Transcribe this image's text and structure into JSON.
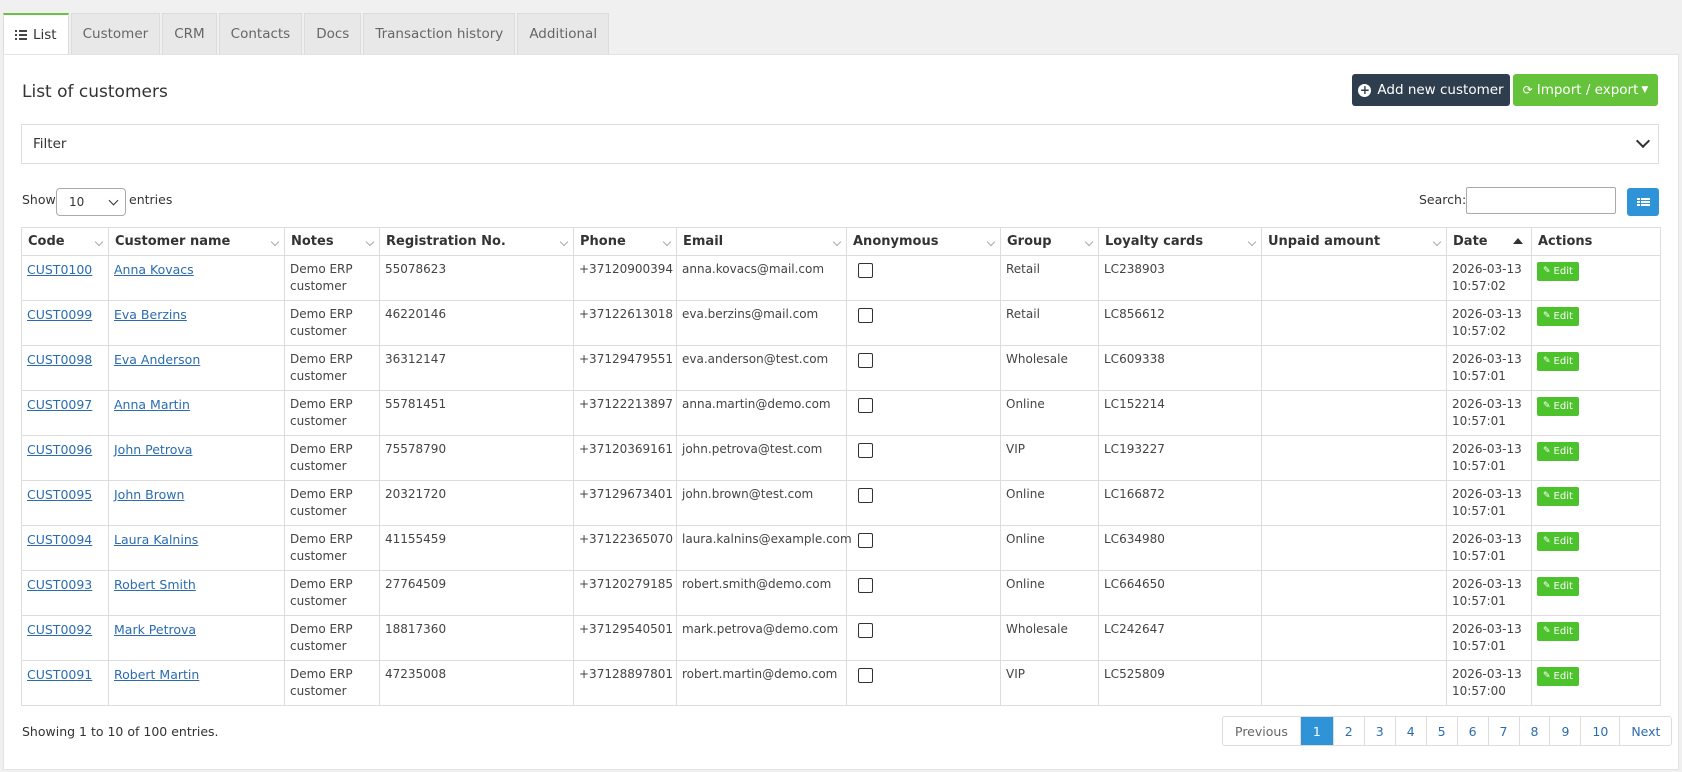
{
  "tabs": [
    {
      "label": "List",
      "active": true
    },
    {
      "label": "Customer"
    },
    {
      "label": "CRM"
    },
    {
      "label": "Contacts"
    },
    {
      "label": "Docs"
    },
    {
      "label": "Transaction history"
    },
    {
      "label": "Additional"
    }
  ],
  "page": {
    "title": "List of customers",
    "add_button": "Add new customer",
    "import_button": "Import / export",
    "filter_label": "Filter"
  },
  "controls": {
    "show_label": "Show",
    "entries_value": "10",
    "entries_label": "entries",
    "search_label": "Search:",
    "search_value": ""
  },
  "table": {
    "columns": [
      "Code",
      "Customer name",
      "Notes",
      "Registration No.",
      "Phone",
      "Email",
      "Anonymous",
      "Group",
      "Loyalty cards",
      "Unpaid amount",
      "Date",
      "Actions"
    ],
    "rows": [
      {
        "code": "CUST0100",
        "name": "Anna Kovacs",
        "notes_1": "Demo ERP",
        "notes_2": "customer",
        "reg": "55078623",
        "phone": "+37120900394",
        "email": "anna.kovacs@mail.com",
        "group": "Retail",
        "loyalty": "LC238903",
        "unpaid": "",
        "date_1": "2026-03-13",
        "date_2": "10:57:02",
        "edit": "Edit"
      },
      {
        "code": "CUST0099",
        "name": "Eva Berzins",
        "notes_1": "Demo ERP",
        "notes_2": "customer",
        "reg": "46220146",
        "phone": "+37122613018",
        "email": "eva.berzins@mail.com",
        "group": "Retail",
        "loyalty": "LC856612",
        "unpaid": "",
        "date_1": "2026-03-13",
        "date_2": "10:57:02",
        "edit": "Edit"
      },
      {
        "code": "CUST0098",
        "name": "Eva Anderson",
        "notes_1": "Demo ERP",
        "notes_2": "customer",
        "reg": "36312147",
        "phone": "+37129479551",
        "email": "eva.anderson@test.com",
        "group": "Wholesale",
        "loyalty": "LC609338",
        "unpaid": "",
        "date_1": "2026-03-13",
        "date_2": "10:57:01",
        "edit": "Edit"
      },
      {
        "code": "CUST0097",
        "name": "Anna Martin",
        "notes_1": "Demo ERP",
        "notes_2": "customer",
        "reg": "55781451",
        "phone": "+37122213897",
        "email": "anna.martin@demo.com",
        "group": "Online",
        "loyalty": "LC152214",
        "unpaid": "",
        "date_1": "2026-03-13",
        "date_2": "10:57:01",
        "edit": "Edit"
      },
      {
        "code": "CUST0096",
        "name": "John Petrova",
        "notes_1": "Demo ERP",
        "notes_2": "customer",
        "reg": "75578790",
        "phone": "+37120369161",
        "email": "john.petrova@test.com",
        "group": "VIP",
        "loyalty": "LC193227",
        "unpaid": "",
        "date_1": "2026-03-13",
        "date_2": "10:57:01",
        "edit": "Edit"
      },
      {
        "code": "CUST0095",
        "name": "John Brown",
        "notes_1": "Demo ERP",
        "notes_2": "customer",
        "reg": "20321720",
        "phone": "+37129673401",
        "email": "john.brown@test.com",
        "group": "Online",
        "loyalty": "LC166872",
        "unpaid": "",
        "date_1": "2026-03-13",
        "date_2": "10:57:01",
        "edit": "Edit"
      },
      {
        "code": "CUST0094",
        "name": "Laura Kalnins",
        "notes_1": "Demo ERP",
        "notes_2": "customer",
        "reg": "41155459",
        "phone": "+37122365070",
        "email": "laura.kalnins@example.com",
        "group": "Online",
        "loyalty": "LC634980",
        "unpaid": "",
        "date_1": "2026-03-13",
        "date_2": "10:57:01",
        "edit": "Edit"
      },
      {
        "code": "CUST0093",
        "name": "Robert Smith",
        "notes_1": "Demo ERP",
        "notes_2": "customer",
        "reg": "27764509",
        "phone": "+37120279185",
        "email": "robert.smith@demo.com",
        "group": "Online",
        "loyalty": "LC664650",
        "unpaid": "",
        "date_1": "2026-03-13",
        "date_2": "10:57:01",
        "edit": "Edit"
      },
      {
        "code": "CUST0092",
        "name": "Mark Petrova",
        "notes_1": "Demo ERP",
        "notes_2": "customer",
        "reg": "18817360",
        "phone": "+37129540501",
        "email": "mark.petrova@demo.com",
        "group": "Wholesale",
        "loyalty": "LC242647",
        "unpaid": "",
        "date_1": "2026-03-13",
        "date_2": "10:57:01",
        "edit": "Edit"
      },
      {
        "code": "CUST0091",
        "name": "Robert Martin",
        "notes_1": "Demo ERP",
        "notes_2": "customer",
        "reg": "47235008",
        "phone": "+37128897801",
        "email": "robert.martin@demo.com",
        "group": "VIP",
        "loyalty": "LC525809",
        "unpaid": "",
        "date_1": "2026-03-13",
        "date_2": "10:57:00",
        "edit": "Edit"
      }
    ]
  },
  "footer": {
    "info": "Showing 1 to 10 of 100 entries.",
    "pagination": [
      "Previous",
      "1",
      "2",
      "3",
      "4",
      "5",
      "6",
      "7",
      "8",
      "9",
      "10",
      "Next"
    ],
    "current_page": "1"
  }
}
